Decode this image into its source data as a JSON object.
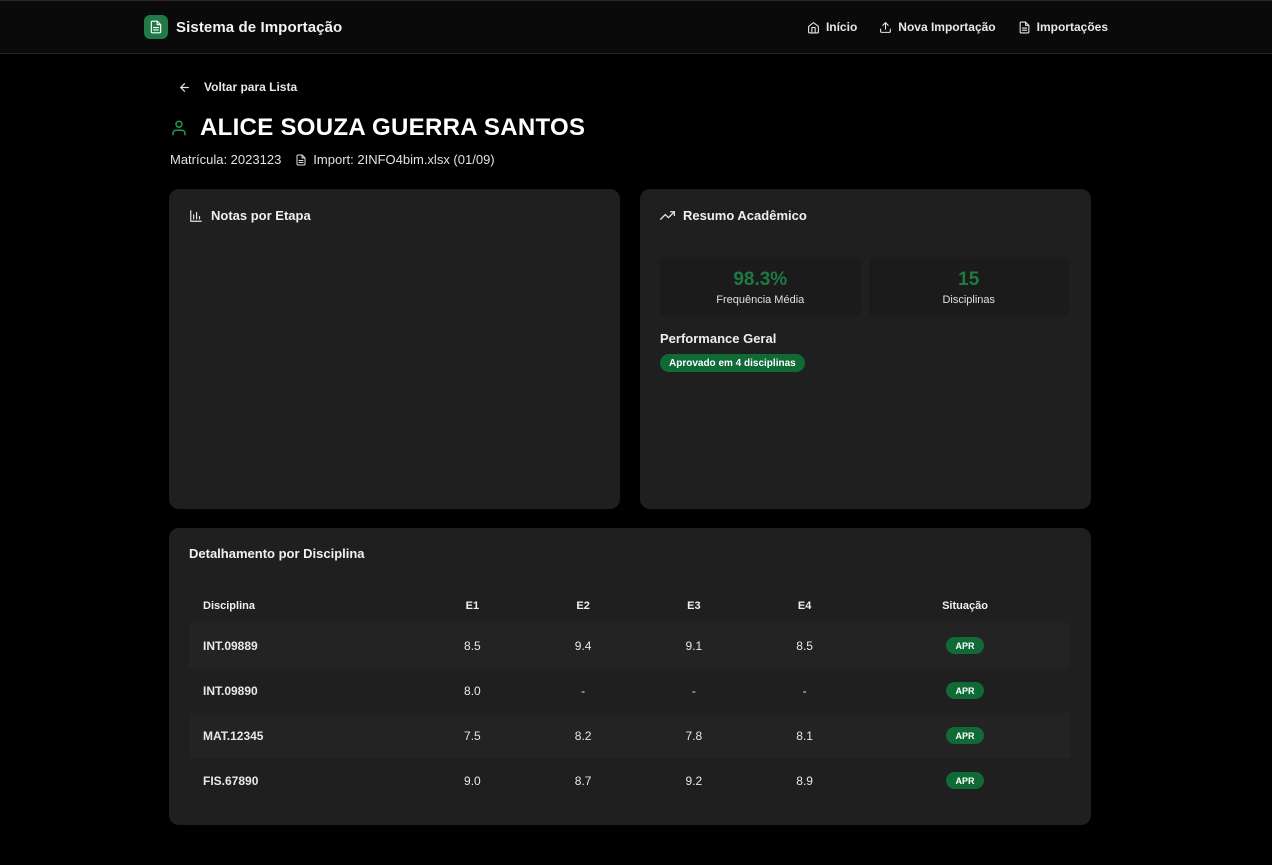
{
  "app": {
    "title": "Sistema de Importação"
  },
  "nav": {
    "items": [
      {
        "label": "Início"
      },
      {
        "label": "Nova Importação"
      },
      {
        "label": "Importações"
      }
    ]
  },
  "back_label": "Voltar para Lista",
  "student": {
    "name": "ALICE SOUZA GUERRA SANTOS",
    "matricula": "Matrícula: 2023123",
    "import": "Import: 2INFO4bim.xlsx (01/09)"
  },
  "notas_card": {
    "title": "Notas por Etapa"
  },
  "resumo_card": {
    "title": "Resumo Acadêmico",
    "stats": [
      {
        "value": "98.3%",
        "label": "Frequência Média"
      },
      {
        "value": "15",
        "label": "Disciplinas"
      }
    ],
    "performance_title": "Performance Geral",
    "performance_badge": "Aprovado em 4 disciplinas"
  },
  "detalhe": {
    "title": "Detalhamento por Disciplina",
    "headers": [
      "Disciplina",
      "E1",
      "E2",
      "E3",
      "E4",
      "Situação"
    ],
    "rows": [
      [
        "INT.09889",
        "8.5",
        "9.4",
        "9.1",
        "8.5",
        "APR"
      ],
      [
        "INT.09890",
        "8.0",
        "-",
        "-",
        "-",
        "APR"
      ],
      [
        "MAT.12345",
        "7.5",
        "8.2",
        "7.8",
        "8.1",
        "APR"
      ],
      [
        "FIS.67890",
        "9.0",
        "8.7",
        "9.2",
        "8.9",
        "APR"
      ]
    ]
  },
  "colors": {
    "accent": "#1f7a45",
    "badge": "#0f6a35",
    "background": "#000000",
    "card": "#1f1f1f"
  },
  "icons": {
    "brand": "file-text-icon",
    "home": "home-icon",
    "upload": "upload-icon",
    "imports": "file-text-icon",
    "back": "arrow-left-icon",
    "user": "user-icon",
    "file": "file-icon",
    "chart": "bar-chart-icon",
    "trend": "trending-up-icon"
  }
}
